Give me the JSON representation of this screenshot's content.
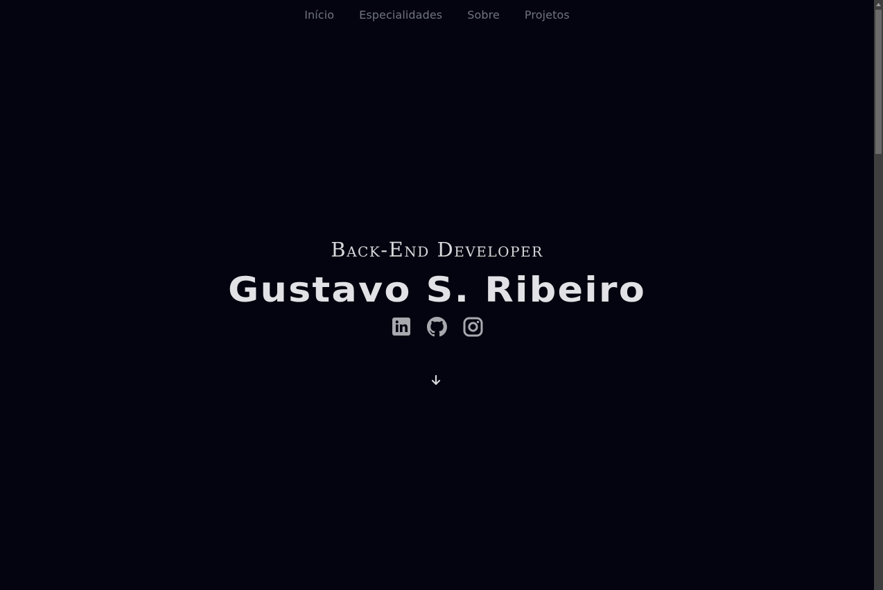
{
  "nav": {
    "items": [
      {
        "label": "Início"
      },
      {
        "label": "Especialidades"
      },
      {
        "label": "Sobre"
      },
      {
        "label": "Projetos"
      }
    ]
  },
  "hero": {
    "role": "Back-End Developer",
    "name": "Gustavo S. Ribeiro"
  },
  "socials": {
    "icons": [
      "linkedin-icon",
      "github-icon",
      "instagram-icon"
    ]
  },
  "scroll_down": {
    "icon": "arrow-down-icon"
  },
  "colors": {
    "background": "#03040f",
    "nav_text": "#70747f",
    "heading_text": "#e2e2e6",
    "icon": "#a8a9ae"
  }
}
